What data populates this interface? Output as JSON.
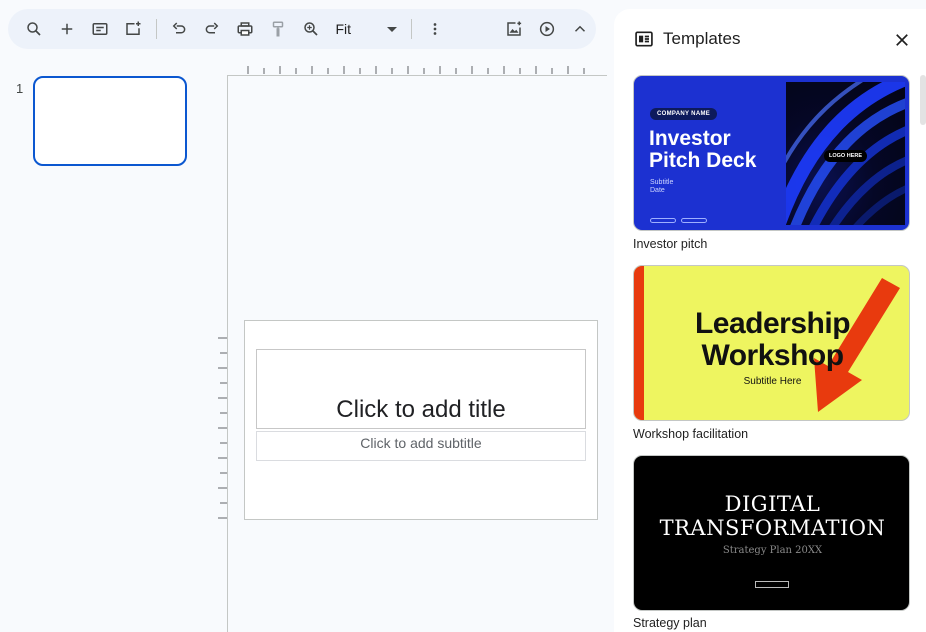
{
  "toolbar": {
    "zoom": {
      "value": "Fit"
    },
    "icons": [
      "search-icon",
      "add-icon",
      "layout-icon",
      "new-slide-icon",
      "undo-icon",
      "redo-icon",
      "print-icon",
      "paint-format-icon",
      "zoom-icon",
      "more-icon",
      "insert-image-icon",
      "present-icon",
      "collapse-icon"
    ]
  },
  "filmstrip": {
    "slides": [
      {
        "number": "1"
      }
    ]
  },
  "slide": {
    "title_placeholder": "Click to add title",
    "subtitle_placeholder": "Click to add subtitle"
  },
  "templates_panel": {
    "title": "Templates",
    "templates": [
      {
        "label": "Investor pitch",
        "company": "COMPANY NAME",
        "line1": "Investor",
        "line2": "Pitch Deck",
        "sub1": "Subtitle",
        "sub2": "Date",
        "logo": "LOGO HERE"
      },
      {
        "label": "Workshop facilitation",
        "line1": "Leadership",
        "line2": "Workshop",
        "sub1": "Subtitle Here"
      },
      {
        "label": "Strategy plan",
        "line1": "DIGITAL",
        "line2": "TRANSFORMATION",
        "sub1": "Strategy Plan 20XX"
      }
    ]
  },
  "colors": {
    "accent": "#0b57d0",
    "toolbar_bg": "#edf2fa",
    "page_bg": "#f8fafd"
  }
}
